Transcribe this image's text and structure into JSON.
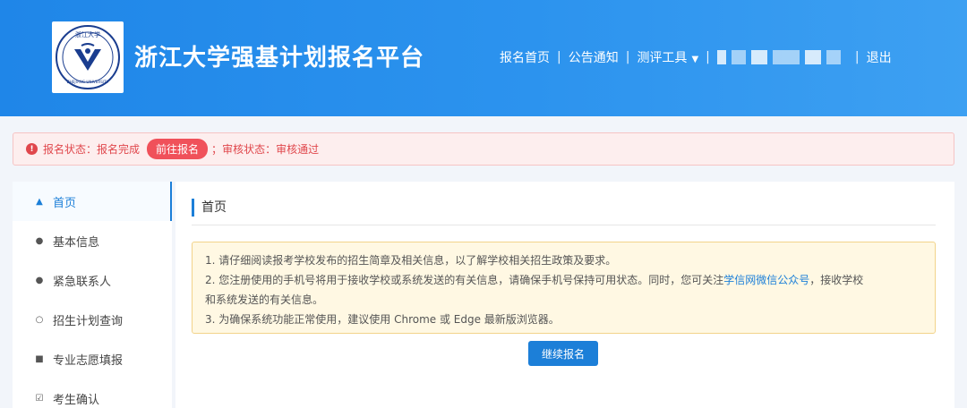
{
  "header": {
    "site_title": "浙江大学强基计划报名平台",
    "logo": {
      "script_text": "浙江大学",
      "university_text": "ZHEJIANG UNIVERSITY"
    },
    "nav": {
      "home": "报名首页",
      "separator": "|",
      "announcements": "公告通知",
      "tools": "测评工具",
      "logout": "退出"
    }
  },
  "status": {
    "reg_label": "报名状态：",
    "reg_value": "报名完成",
    "go_button": "前往报名",
    "semicolon": "；",
    "review_label": "审核状态：",
    "review_value": "审核通过"
  },
  "sidebar": {
    "items": [
      {
        "label": "首页",
        "icon": "home-icon"
      },
      {
        "label": "基本信息",
        "icon": "user-icon"
      },
      {
        "label": "紧急联系人",
        "icon": "user-icon"
      },
      {
        "label": "招生计划查询",
        "icon": "search-icon"
      },
      {
        "label": "专业志愿填报",
        "icon": "document-icon"
      },
      {
        "label": "考生确认",
        "icon": "checkbox-icon"
      }
    ]
  },
  "main": {
    "title": "首页",
    "notice": {
      "line1": "1. 请仔细阅读报考学校发布的招生简章及相关信息，以了解学校相关招生政策及要求。",
      "line2_before": "2. 您注册使用的手机号将用于接收学校或系统发送的有关信息，请确保手机号保持可用状态。同时，您可关注",
      "line2_link": "学信网微信公众号",
      "line2_after": "，接收学校",
      "line2_cont": "和系统发送的有关信息。",
      "line3": "3. 为确保系统功能正常使用，建议使用 Chrome 或 Edge 最新版浏览器。"
    },
    "continue_button": "继续报名"
  },
  "colors": {
    "header_blue": "#1f86e8",
    "accent_blue": "#1c7fd8",
    "status_red": "#e0474c",
    "notice_bg": "#fff8e3"
  }
}
